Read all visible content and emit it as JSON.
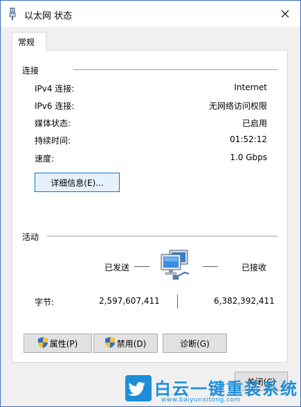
{
  "window": {
    "title": "以太网 状态"
  },
  "tabs": [
    {
      "label": "常规"
    }
  ],
  "connection": {
    "section_title": "连接",
    "rows": [
      {
        "label": "IPv4 连接:",
        "value": "Internet"
      },
      {
        "label": "IPv6 连接:",
        "value": "无网络访问权限"
      },
      {
        "label": "媒体状态:",
        "value": "已启用"
      },
      {
        "label": "持续时间:",
        "value": "01:52:12"
      },
      {
        "label": "速度:",
        "value": "1.0 Gbps"
      }
    ],
    "details_button": "详细信息(E)..."
  },
  "activity": {
    "section_title": "活动",
    "sent_label": "已发送",
    "received_label": "已接收",
    "bytes_label": "字节:",
    "bytes_sent": "2,597,607,411",
    "bytes_received": "6,382,392,411",
    "network_icon": "network-computers-icon"
  },
  "buttons": {
    "properties": "属性(P)",
    "disable": "禁用(D)",
    "diagnose": "诊断(G)",
    "close": "关闭(C)"
  },
  "watermark": {
    "text": "白云一键重装系统",
    "url": "www.baiyunxitong.com",
    "icon": "twitter-bird-icon"
  },
  "colors": {
    "accent": "#0078d7",
    "window_border": "#3c6eb4",
    "watermark": "#1d8fd8"
  }
}
